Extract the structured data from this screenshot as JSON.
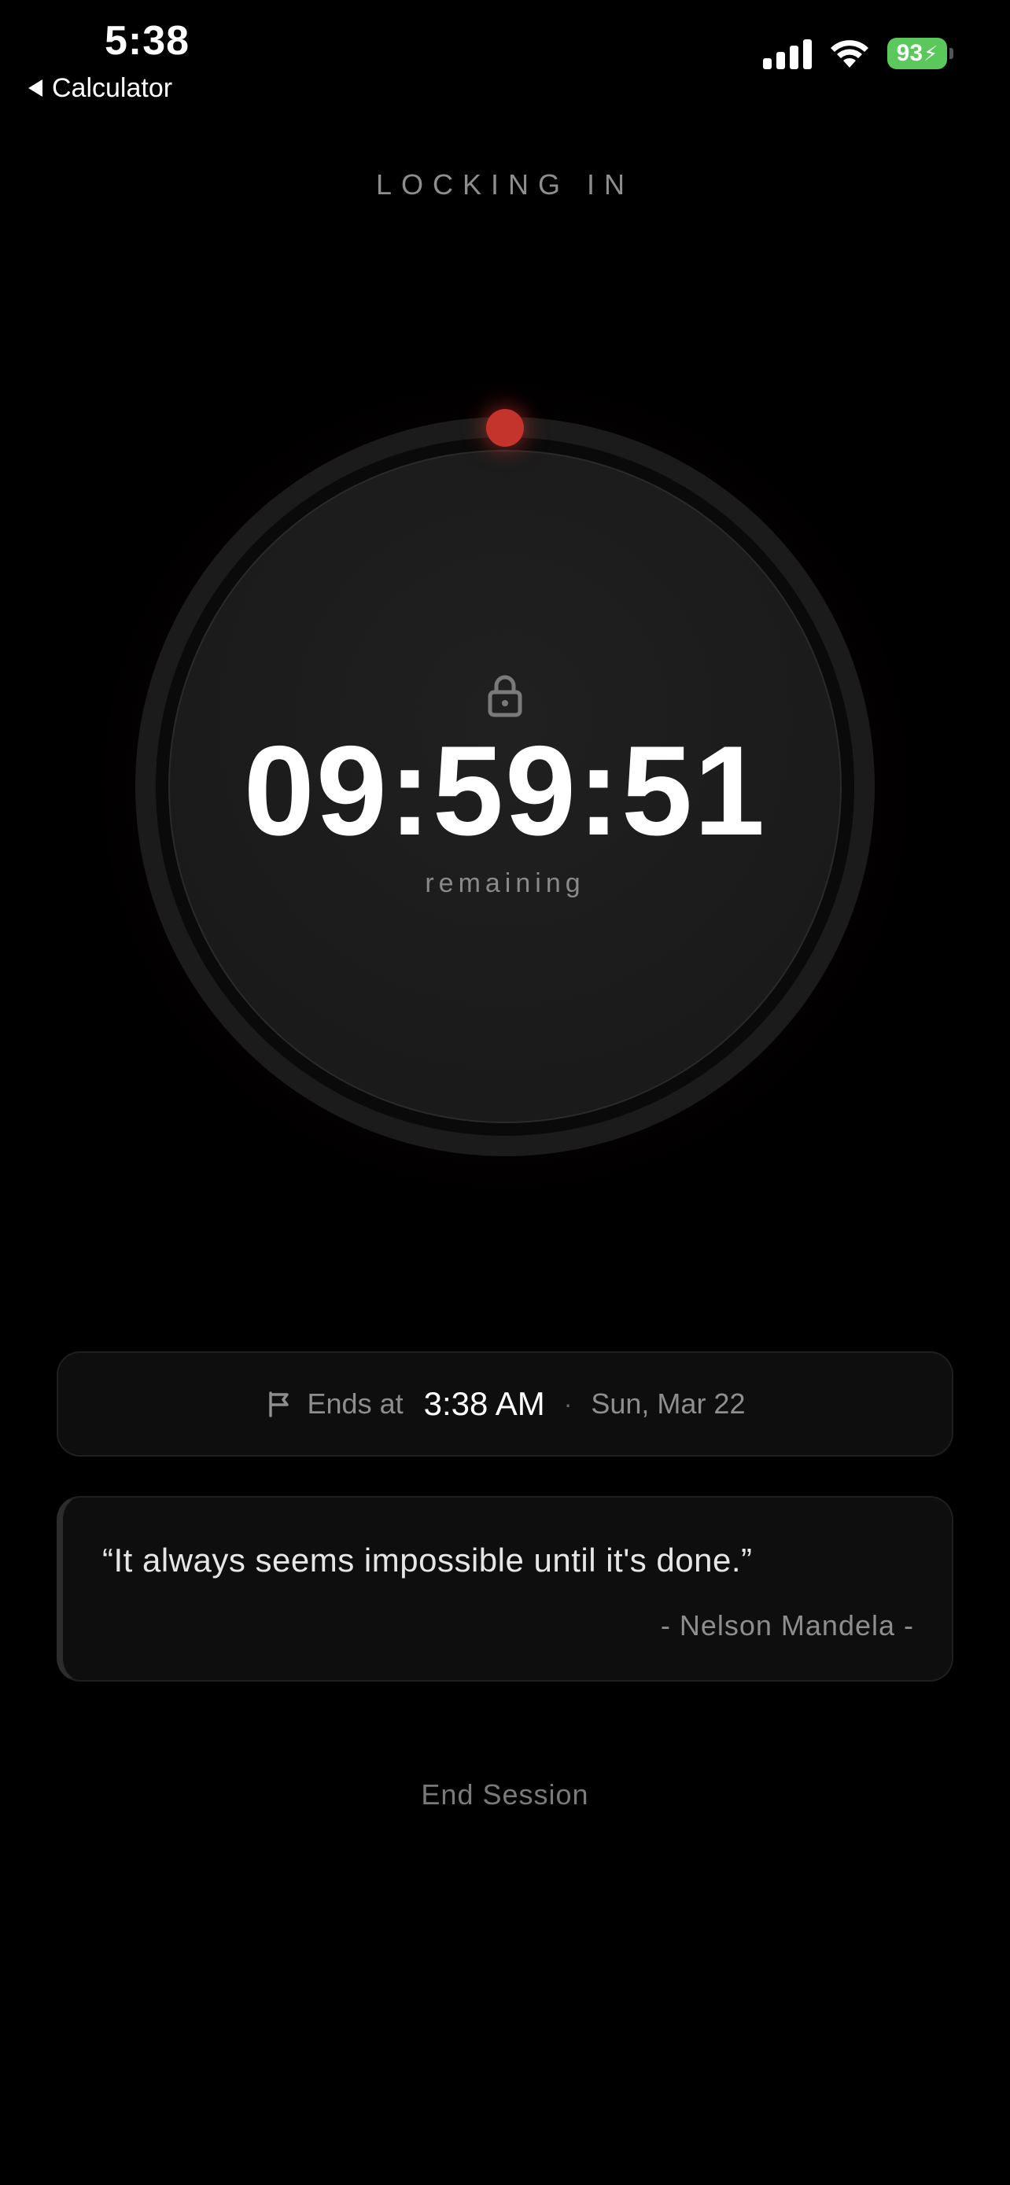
{
  "status_bar": {
    "time": "5:38",
    "back_label": "Calculator",
    "battery": "93",
    "icons": [
      "signal-icon",
      "wifi-icon",
      "battery-icon"
    ]
  },
  "header": {
    "title": "LOCKING IN"
  },
  "timer": {
    "countdown": "09:59:51",
    "label": "remaining",
    "accent_color": "#c5342c",
    "icon": "lock-icon"
  },
  "ends": {
    "label": "Ends at",
    "time": "3:38 AM",
    "separator": "·",
    "date": "Sun, Mar 22",
    "icon": "flag-icon"
  },
  "quote": {
    "text": "“It always seems impossible until it's done.”",
    "author": "- Nelson Mandela -"
  },
  "actions": {
    "end_session": "End Session"
  }
}
